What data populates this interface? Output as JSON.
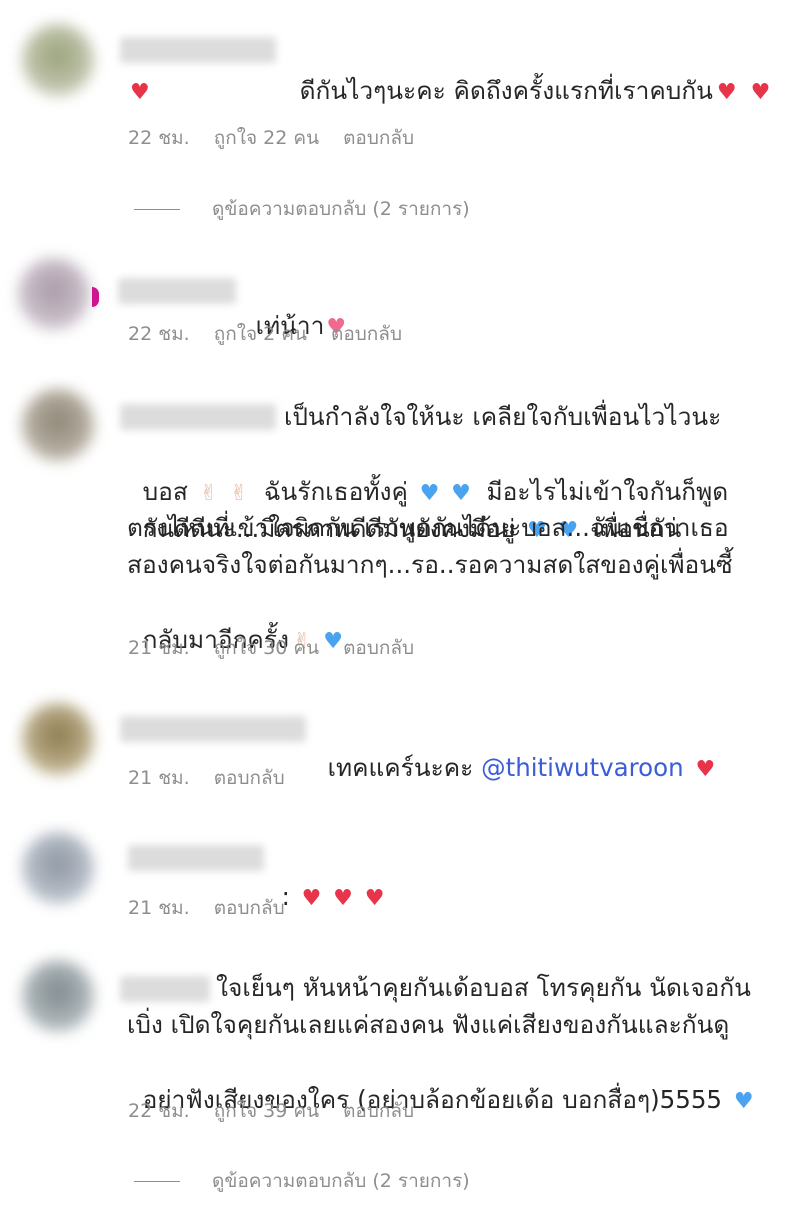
{
  "comments": [
    {
      "text": "ดีกันไวๆนะคะ คิดถึงครั้งแรกที่เราคบกัน",
      "emojis": [
        "red-heart",
        "red-heart",
        "red-heart"
      ],
      "time": "22 ชม.",
      "likes": "ถูกใจ 22 คน",
      "reply": "ตอบกลับ",
      "view_replies": "ดูข้อความตอบกลับ (2 รายการ)"
    },
    {
      "text": "เท่น้าา",
      "emojis": [
        "sparkling-heart"
      ],
      "time": "22 ชม.",
      "likes": "ถูกใจ 2 คน",
      "reply": "ตอบกลับ"
    },
    {
      "line1": "เป็นกำลังใจให้นะ เคลียใจกับเพื่อนไวไวนะ",
      "line2a": "บอส",
      "line2b": "ฉันรักเธอทั้งคู่",
      "line2c": "มีอะไรไม่เข้าใจกันก็พูด",
      "line3a": "กันดีดีนะ...มิตรภาพดีดีมันยังคงมีอยู่",
      "line3b": "เพื่อนกัน",
      "line4": "ตรงไหนที่เข้าใจผิดกัน เราพูดกันได้นะบอส...ฉันเชื่อว่าเธอ",
      "line5": "สองคนจริงใจต่อกันมากๆ...รอ..รอความสดใสของคู่เพื่อนซี้",
      "line6": "กลับมาอีกครั้ง",
      "emojis": [
        "victory-hand",
        "blue-heart"
      ],
      "time": "21 ชม.",
      "likes": "ถูกใจ 30 คน",
      "reply": "ตอบกลับ"
    },
    {
      "text": "เทคแคร์นะคะ",
      "mention": "@thitiwutvaroon",
      "emojis": [
        "red-heart"
      ],
      "time": "21 ชม.",
      "reply": "ตอบกลับ"
    },
    {
      "text": ":",
      "emojis": [
        "red-heart",
        "red-heart",
        "red-heart"
      ],
      "time": "21 ชม.",
      "reply": "ตอบกลับ"
    },
    {
      "line1": "ใจเย็นๆ หันหน้าคุยกันเด้อบอส โทรคุยกัน นัดเจอกัน",
      "line2": "เบิ่ง เปิดใจคุยกันเลยแค่สองคน ฟังแค่เสียงของกันและกันดู",
      "line3": "อย่าฟังเสียงของใคร (อย่าบล้อกข้อยเด้อ บอกสื่อๆ)5555",
      "emojis": [
        "blue-heart"
      ],
      "time": "22 ชม.",
      "likes": "ถูกใจ 39 คน",
      "reply": "ตอบกลับ",
      "view_replies": "ดูข้อความตอบกลับ (2 รายการ)"
    }
  ],
  "glyphs": {
    "heart": "♥",
    "peace": "✌"
  },
  "colors": {
    "mention": "#3b5ed6",
    "meta": "#8e8e8e",
    "red_heart": "#e8344b",
    "blue_heart": "#4aa3ef"
  }
}
